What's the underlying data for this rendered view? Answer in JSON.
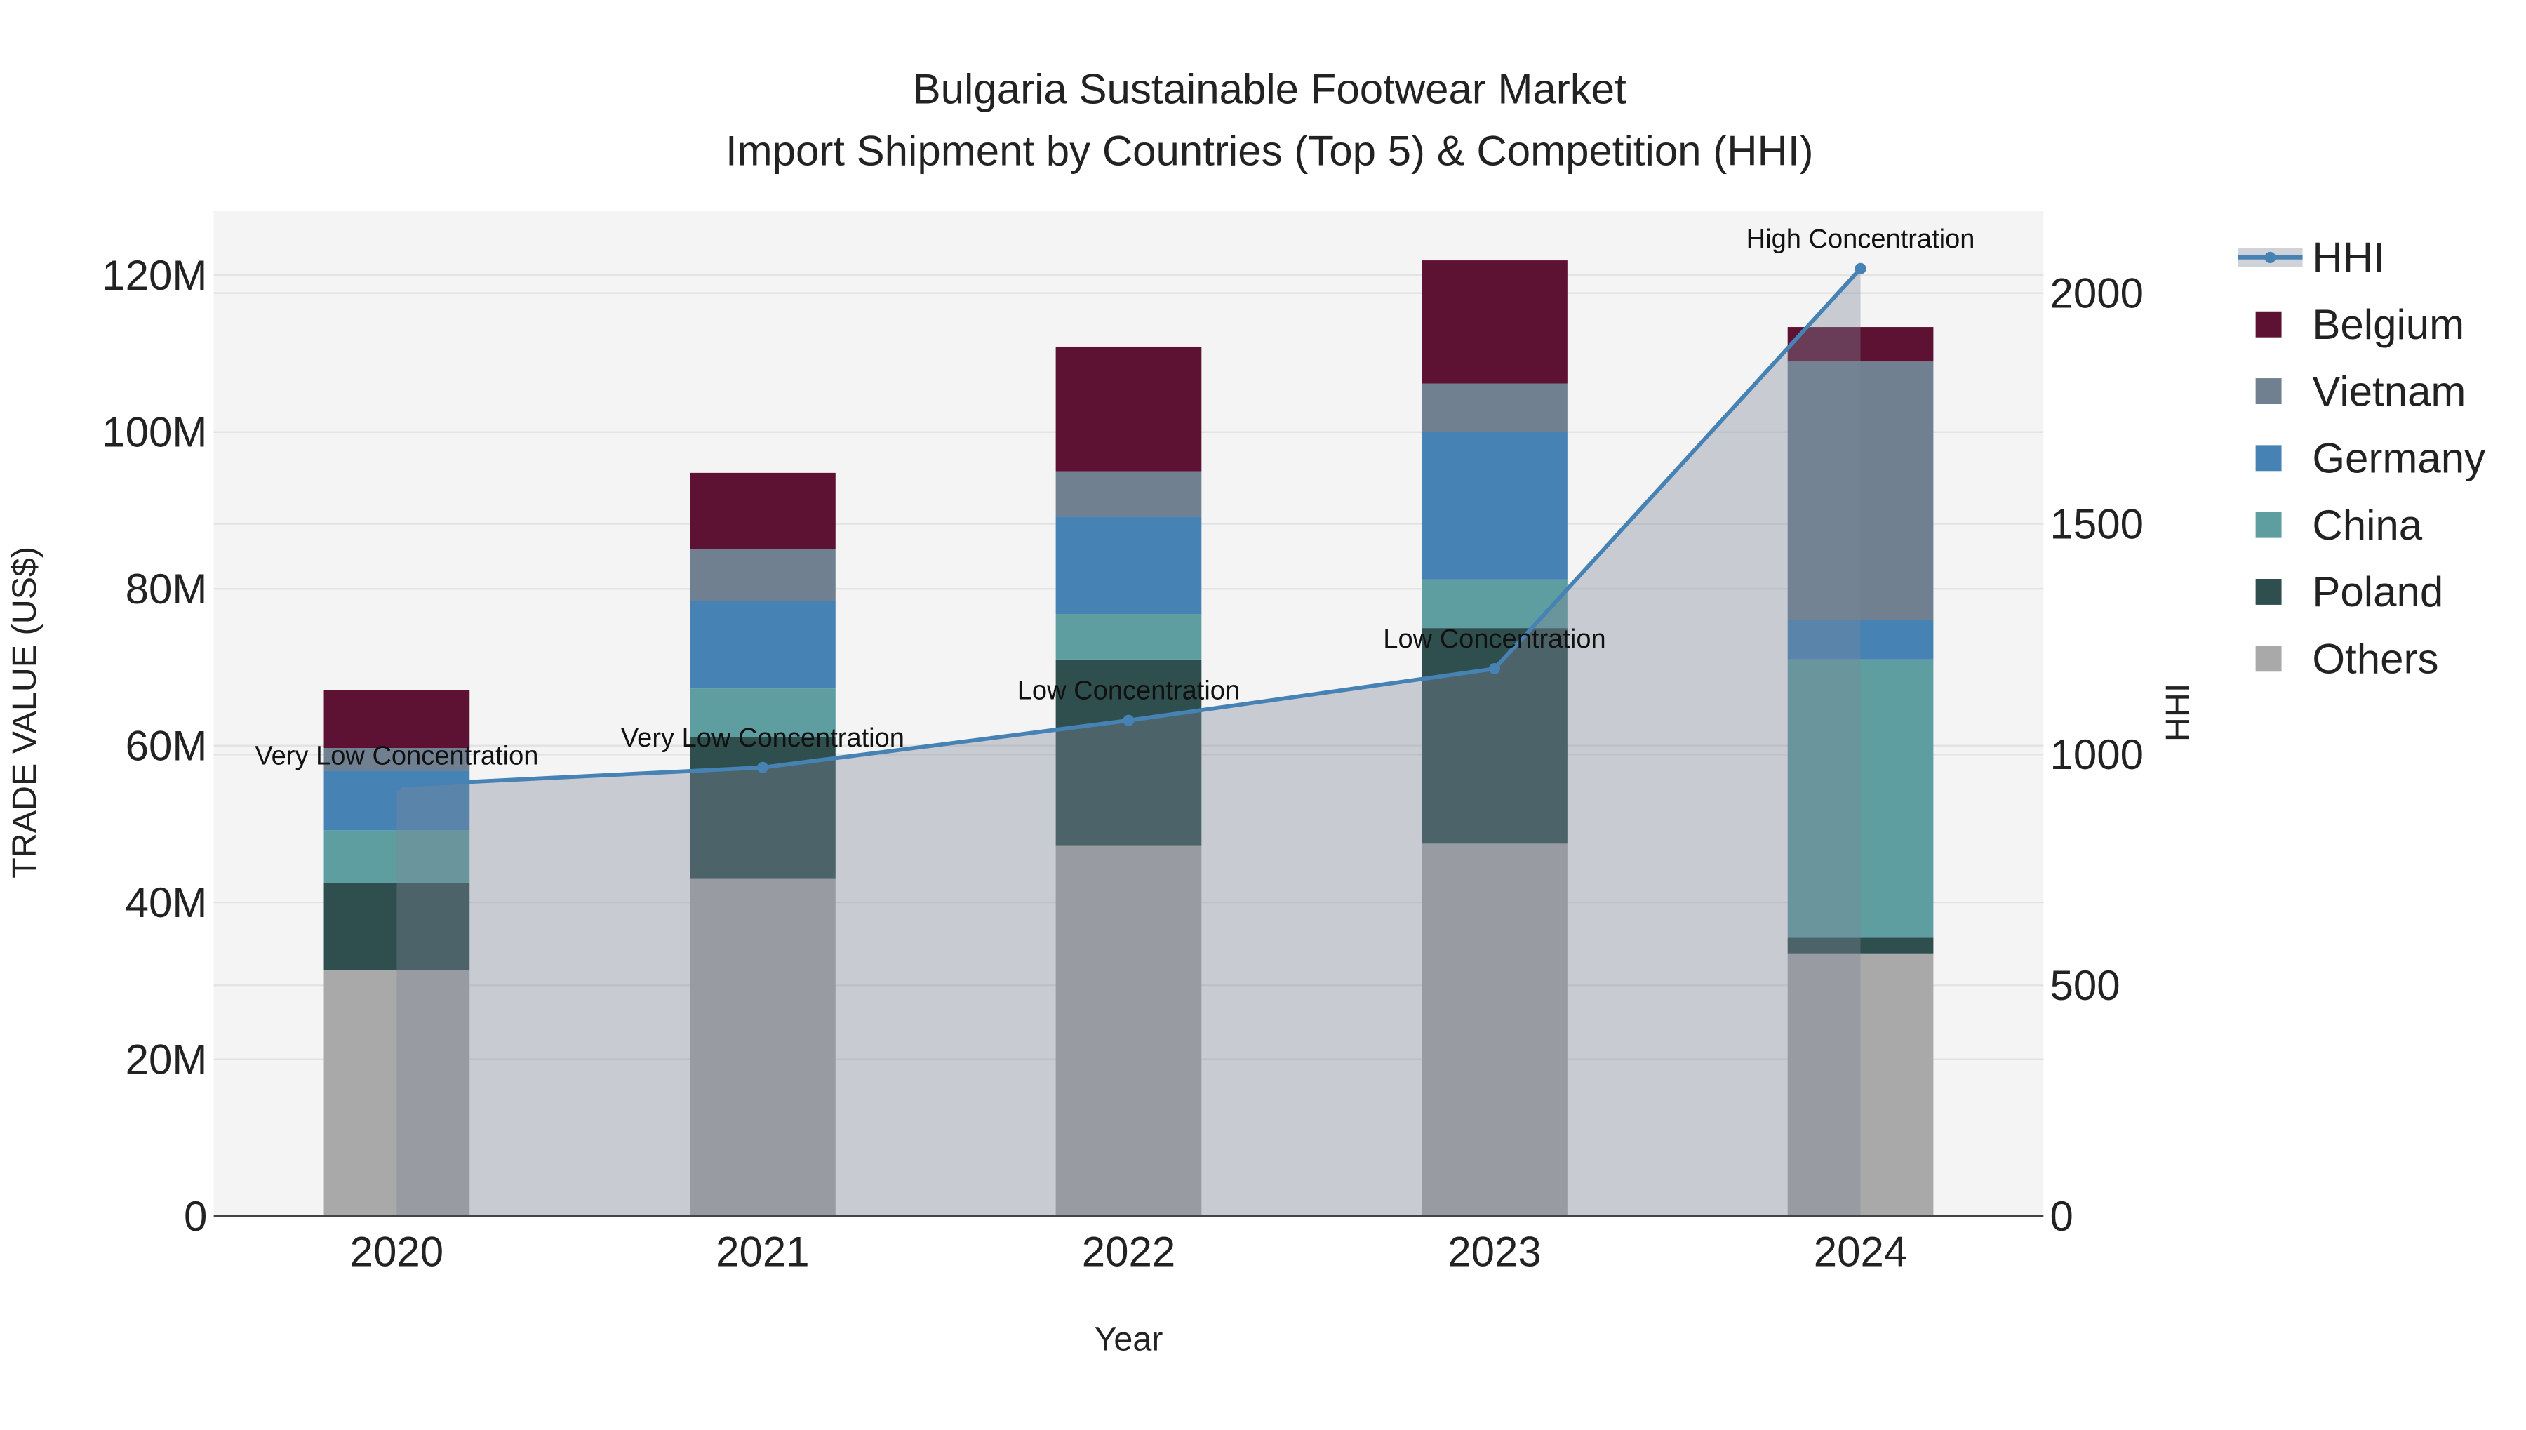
{
  "chart_data": {
    "type": "bar",
    "title": "Bulgaria Sustainable Footwear Market",
    "subtitle": "Import Shipment by Countries (Top 5) & Competition (HHI)",
    "xlabel": "Year",
    "ylabel": "TRADE VALUE (US$)",
    "y2label": "HHI",
    "categories": [
      "2020",
      "2021",
      "2022",
      "2023",
      "2024"
    ],
    "stacked": true,
    "ylim": [
      0,
      128
    ],
    "yticks": [
      0,
      20,
      40,
      60,
      80,
      100,
      120
    ],
    "ytick_labels": [
      "0",
      "20M",
      "40M",
      "60M",
      "80M",
      "100M",
      "120M"
    ],
    "y2lim": [
      0,
      2180
    ],
    "y2ticks": [
      0,
      500,
      1000,
      1500,
      2000
    ],
    "y2tick_labels": [
      "0",
      "500",
      "1000",
      "1500",
      "2000"
    ],
    "unit": "million US$",
    "grid": true,
    "legend_position": "right",
    "series": [
      {
        "name": "Others",
        "color": "#a9a9a9",
        "values": [
          31.4,
          43.0,
          47.3,
          47.5,
          33.5
        ]
      },
      {
        "name": "Poland",
        "color": "#2f4f4f",
        "values": [
          11.1,
          18.1,
          23.7,
          27.5,
          2.0
        ]
      },
      {
        "name": "China",
        "color": "#5f9ea0",
        "values": [
          6.7,
          6.2,
          5.8,
          6.2,
          35.5
        ]
      },
      {
        "name": "Germany",
        "color": "#4682b4",
        "values": [
          7.6,
          11.2,
          12.4,
          18.8,
          5.0
        ]
      },
      {
        "name": "Vietnam",
        "color": "#708090",
        "values": [
          2.9,
          6.6,
          5.8,
          6.2,
          33.0
        ]
      },
      {
        "name": "Belgium",
        "color": "#5e1233",
        "values": [
          7.4,
          9.7,
          15.9,
          15.7,
          4.4
        ]
      }
    ],
    "hhi": {
      "name": "HHI",
      "color": "#4682b4",
      "values": [
        933,
        972,
        1074,
        1186,
        2053
      ],
      "annotations": [
        "Very Low Concentration",
        "Very Low Concentration",
        "Low Concentration",
        "Low Concentration",
        "High Concentration"
      ]
    },
    "legend_order": [
      "HHI",
      "Belgium",
      "Vietnam",
      "Germany",
      "China",
      "Poland",
      "Others"
    ]
  }
}
